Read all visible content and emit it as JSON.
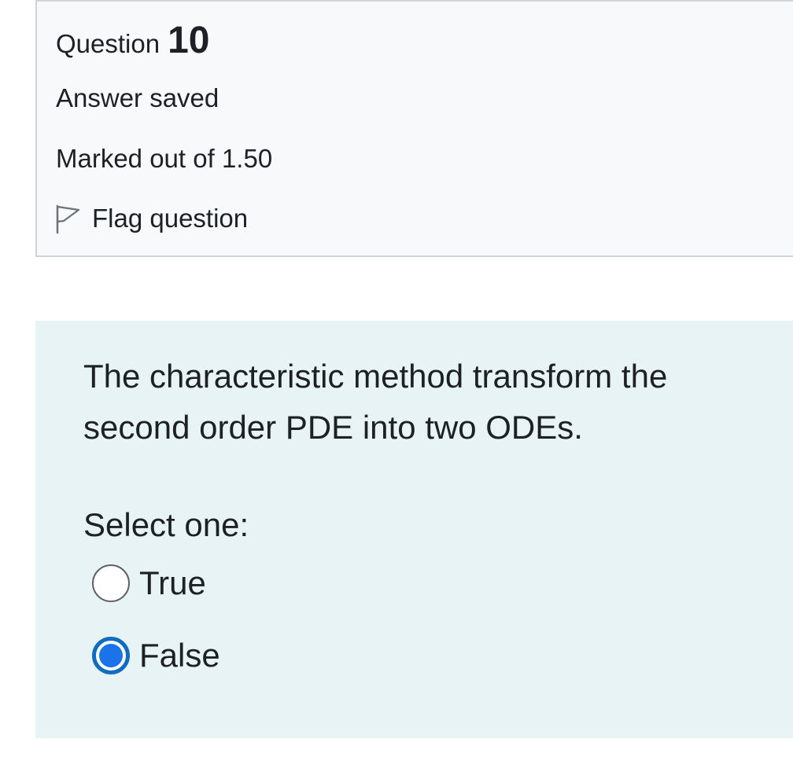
{
  "question_info": {
    "question_word": "Question",
    "question_number": "10",
    "state": "Answer saved",
    "grade": "Marked out of 1.50",
    "flag_label": "Flag question",
    "flag_icon": "flag-outline-icon"
  },
  "question": {
    "text": "The characteristic method transform the second order PDE into two ODEs.",
    "prompt": "Select one:",
    "options": [
      {
        "label": "True",
        "selected": false
      },
      {
        "label": "False",
        "selected": true
      }
    ]
  },
  "colors": {
    "info_background": "#f8f9fa",
    "info_border": "#ced4da",
    "content_background": "#e7f3f5",
    "radio_selected": "#1a73e8"
  }
}
